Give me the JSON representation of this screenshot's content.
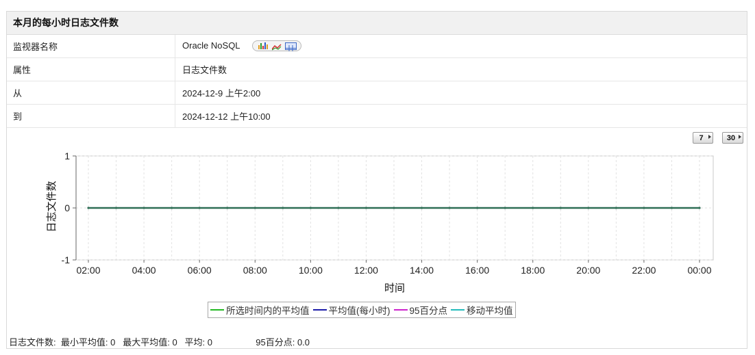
{
  "panel": {
    "title": "本月的每小时日志文件数"
  },
  "info": {
    "rows": [
      {
        "key": "监视器名称",
        "value": "Oracle NoSQL"
      },
      {
        "key": "属性",
        "value": "日志文件数"
      },
      {
        "key": "从",
        "value": "2024-12-9 上午2:00"
      },
      {
        "key": "到",
        "value": "2024-12-12 上午10:00"
      }
    ],
    "icons": [
      "bar-chart-icon",
      "line-chart-icon",
      "table-icon"
    ]
  },
  "range_buttons": {
    "seven": "7",
    "thirty": "30"
  },
  "chart_data": {
    "type": "line",
    "ylabel": "日志文件数",
    "xlabel": "时间",
    "ylim": [
      -1,
      1
    ],
    "yticks": [
      1,
      0,
      -1
    ],
    "xtick_labels": [
      "02:00",
      "04:00",
      "06:00",
      "08:00",
      "10:00",
      "12:00",
      "14:00",
      "16:00",
      "18:00",
      "20:00",
      "22:00",
      "00:00"
    ],
    "x": [
      "02:00",
      "03:00",
      "04:00",
      "05:00",
      "06:00",
      "07:00",
      "08:00",
      "09:00",
      "10:00",
      "11:00",
      "12:00",
      "13:00",
      "14:00",
      "15:00",
      "16:00",
      "17:00",
      "18:00",
      "19:00",
      "20:00",
      "21:00",
      "22:00",
      "23:00",
      "00:00"
    ],
    "series": [
      {
        "name": "所选时间内的平均值",
        "color": "#22b822",
        "values": [
          0,
          0,
          0,
          0,
          0,
          0,
          0,
          0,
          0,
          0,
          0,
          0,
          0,
          0,
          0,
          0,
          0,
          0,
          0,
          0,
          0,
          0,
          0
        ]
      },
      {
        "name": "平均值(每小时)",
        "color": "#1a1aa8",
        "values": [
          0,
          0,
          0,
          0,
          0,
          0,
          0,
          0,
          0,
          0,
          0,
          0,
          0,
          0,
          0,
          0,
          0,
          0,
          0,
          0,
          0,
          0,
          0
        ]
      },
      {
        "name": "95百分点",
        "color": "#cc22cc",
        "values": [
          0,
          0,
          0,
          0,
          0,
          0,
          0,
          0,
          0,
          0,
          0,
          0,
          0,
          0,
          0,
          0,
          0,
          0,
          0,
          0,
          0,
          0,
          0
        ]
      },
      {
        "name": "移动平均值",
        "color": "#22bbbb",
        "values": [
          0,
          0,
          0,
          0,
          0,
          0,
          0,
          0,
          0,
          0,
          0,
          0,
          0,
          0,
          0,
          0,
          0,
          0,
          0,
          0,
          0,
          0,
          0
        ]
      }
    ],
    "grid": true,
    "legend_position": "bottom-center"
  },
  "stats": {
    "label": "日志文件数:",
    "min_label": "最小平均值:",
    "min_value": "0",
    "max_label": "最大平均值:",
    "max_value": "0",
    "avg_label": "平均:",
    "avg_value": "0",
    "p95_label": "95百分点:",
    "p95_value": "0.0"
  }
}
